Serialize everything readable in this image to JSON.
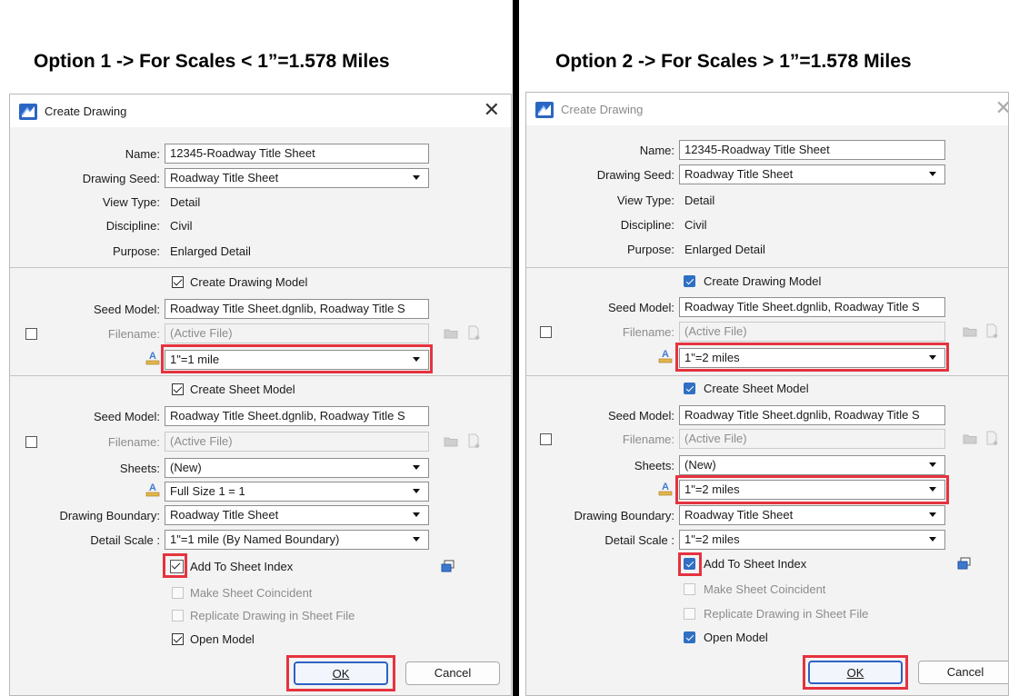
{
  "heading_left": "Option 1  -> For Scales < 1”=1.578 Miles",
  "heading_right": "Option 2 -> For Scales > 1”=1.578 Miles",
  "left": {
    "title": "Create Drawing",
    "close_glyph": "✕",
    "name_label": "Name:",
    "name_value": "12345-Roadway Title Sheet",
    "seed_label": "Drawing Seed:",
    "seed_value": "Roadway Title Sheet",
    "viewtype_label": "View Type:",
    "viewtype_value": "Detail",
    "discipline_label": "Discipline:",
    "discipline_value": "Civil",
    "purpose_label": "Purpose:",
    "purpose_value": "Enlarged Detail",
    "create_drawing_model": "Create Drawing Model",
    "dm_seed_label": "Seed Model:",
    "dm_seed_value": "Roadway Title Sheet.dgnlib, Roadway Title S",
    "dm_filename_label": "Filename:",
    "dm_filename_value": "(Active File)",
    "dm_scale_value": "1\"=1 mile",
    "create_sheet_model": "Create Sheet Model",
    "sm_seed_label": "Seed Model:",
    "sm_seed_value": "Roadway Title Sheet.dgnlib, Roadway Title S",
    "sm_filename_label": "Filename:",
    "sm_filename_value": "(Active File)",
    "sheets_label": "Sheets:",
    "sheets_value": "(New)",
    "sm_scale_value": "Full Size 1 = 1",
    "boundary_label": "Drawing Boundary:",
    "boundary_value": "Roadway Title Sheet",
    "detail_label": "Detail Scale :",
    "detail_value": "1\"=1 mile (By Named Boundary)",
    "add_index": "Add To Sheet Index",
    "make_coincident": "Make Sheet Coincident",
    "replicate": "Replicate Drawing in Sheet File",
    "open_model": "Open Model",
    "ok": "OK",
    "cancel": "Cancel"
  },
  "right": {
    "title": "Create Drawing",
    "close_glyph": "✕",
    "name_label": "Name:",
    "name_value": "12345-Roadway Title Sheet",
    "seed_label": "Drawing Seed:",
    "seed_value": "Roadway Title Sheet",
    "viewtype_label": "View Type:",
    "viewtype_value": "Detail",
    "discipline_label": "Discipline:",
    "discipline_value": "Civil",
    "purpose_label": "Purpose:",
    "purpose_value": "Enlarged Detail",
    "create_drawing_model": "Create Drawing Model",
    "dm_seed_label": "Seed Model:",
    "dm_seed_value": "Roadway Title Sheet.dgnlib, Roadway Title S",
    "dm_filename_label": "Filename:",
    "dm_filename_value": "(Active File)",
    "dm_scale_value": "1\"=2 miles",
    "create_sheet_model": "Create Sheet Model",
    "sm_seed_label": "Seed Model:",
    "sm_seed_value": "Roadway Title Sheet.dgnlib, Roadway Title S",
    "sm_filename_label": "Filename:",
    "sm_filename_value": "(Active File)",
    "sheets_label": "Sheets:",
    "sheets_value": "(New)",
    "sm_scale_value": "1\"=2 miles",
    "boundary_label": "Drawing Boundary:",
    "boundary_value": "Roadway Title Sheet",
    "detail_label": "Detail Scale :",
    "detail_value": "1\"=2 miles",
    "add_index": "Add To Sheet Index",
    "make_coincident": "Make Sheet Coincident",
    "replicate": "Replicate Drawing in Sheet File",
    "open_model": "Open Model",
    "ok": "OK",
    "cancel": "Cancel"
  },
  "colors": {
    "highlight": "#e5333f",
    "checkbox_blue": "#2f6fc4",
    "primary_border": "#2e62c4"
  },
  "icons": [
    "app-icon",
    "close-icon",
    "folder-icon",
    "new-file-icon",
    "scale-icon",
    "sheet-index-icon",
    "chevron-down-icon"
  ]
}
